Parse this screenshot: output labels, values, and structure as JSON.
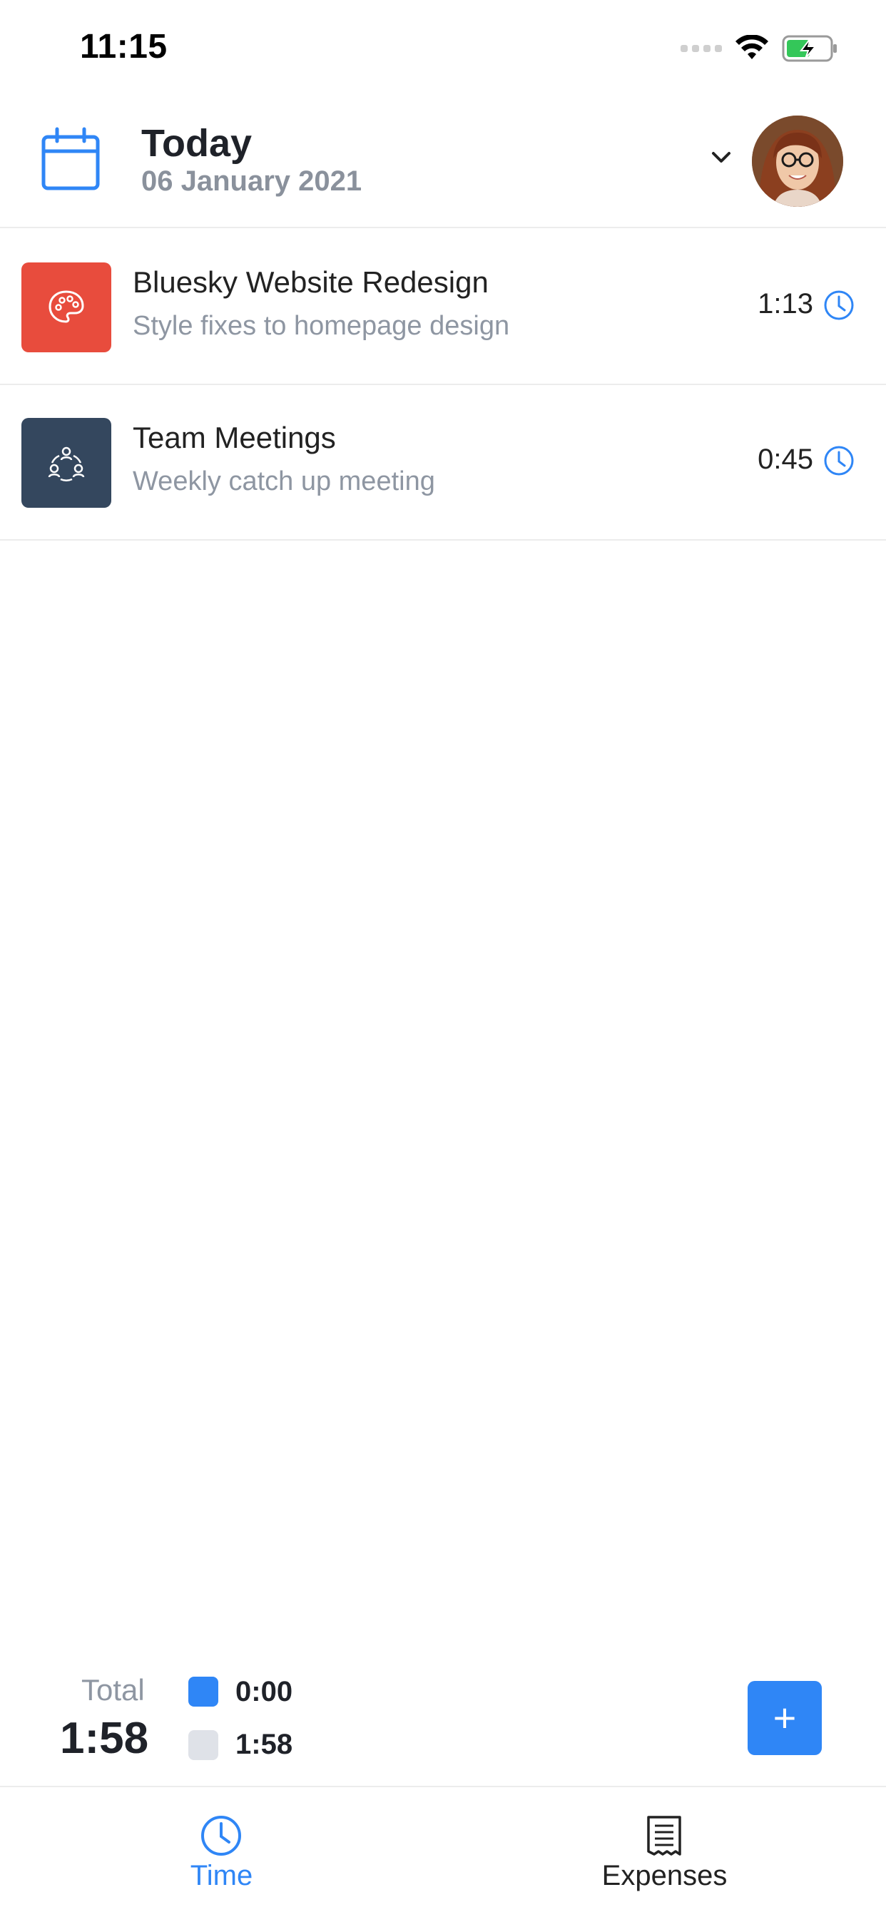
{
  "status_bar": {
    "time": "11:15"
  },
  "header": {
    "title": "Today",
    "date": "06 January 2021"
  },
  "entries": [
    {
      "title": "Bluesky Website Redesign",
      "subtitle": "Style fixes to homepage design",
      "duration": "1:13",
      "icon": "palette-icon",
      "color": "#e84c3d"
    },
    {
      "title": "Team Meetings",
      "subtitle": "Weekly catch up meeting",
      "duration": "0:45",
      "icon": "team-icon",
      "color": "#34475e"
    }
  ],
  "summary": {
    "total_label": "Total",
    "total_value": "1:58",
    "legend": [
      {
        "value": "0:00",
        "color": "#2f86f6"
      },
      {
        "value": "1:58",
        "color": "#dfe2e8"
      }
    ],
    "add_label": "+"
  },
  "tabs": [
    {
      "label": "Time",
      "icon": "clock-icon",
      "active": true
    },
    {
      "label": "Expenses",
      "icon": "receipt-icon",
      "active": false
    }
  ],
  "colors": {
    "accent": "#2f86f6",
    "muted_text": "#8e96a2"
  }
}
